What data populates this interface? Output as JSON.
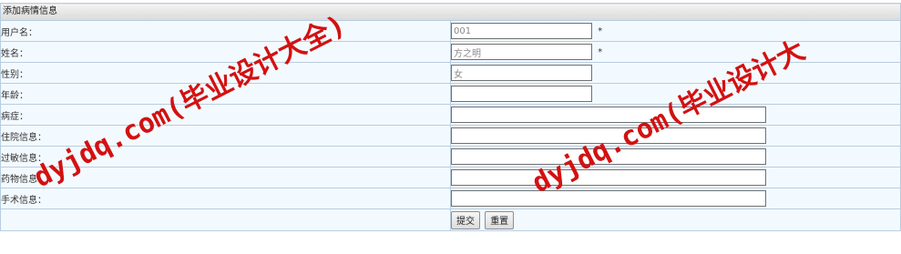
{
  "form": {
    "title": "添加病情信息",
    "fields": [
      {
        "label": "用户名：",
        "value": "001",
        "required_mark": "*"
      },
      {
        "label": "姓名：",
        "value": "方之明",
        "required_mark": "*"
      },
      {
        "label": "性别：",
        "value": "女"
      },
      {
        "label": "年龄：",
        "value": ""
      },
      {
        "label": "病症：",
        "value": ""
      },
      {
        "label": "住院信息：",
        "value": ""
      },
      {
        "label": "过敏信息：",
        "value": ""
      },
      {
        "label": "药物信息：",
        "value": ""
      },
      {
        "label": "手术信息：",
        "value": ""
      }
    ],
    "buttons": {
      "submit": "提交",
      "reset": "重置"
    }
  },
  "watermark": {
    "text_left": "dyjdq.com(毕业设计大全)",
    "text_right": "dyjdq.com(毕业设计大",
    "color": "#d31111"
  }
}
